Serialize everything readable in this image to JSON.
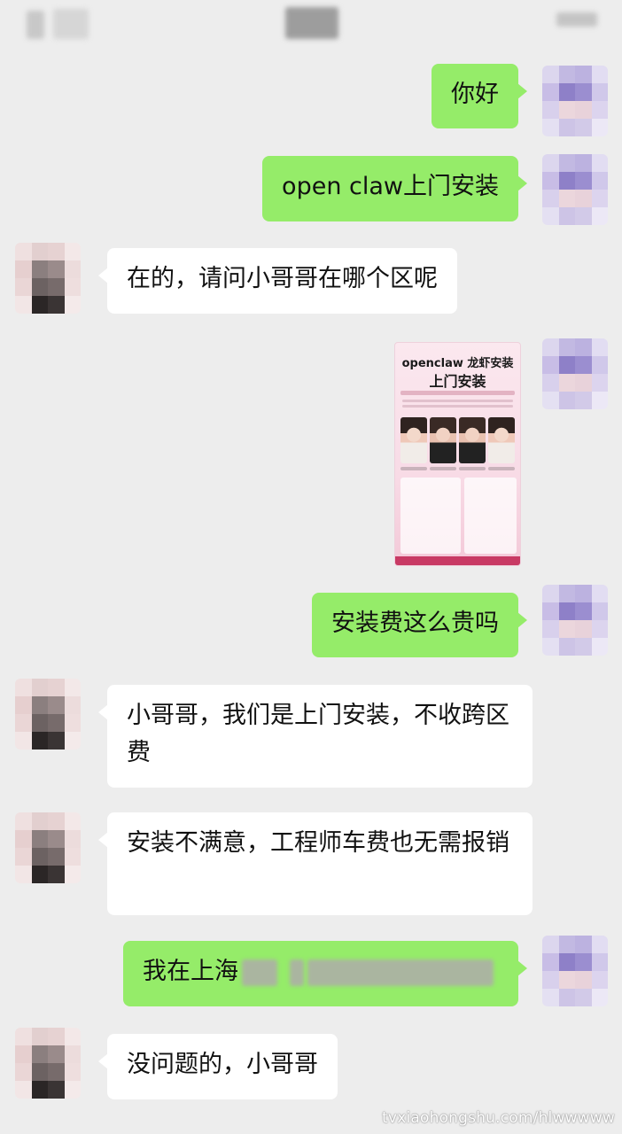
{
  "header": {},
  "messages": [
    {
      "from": "me",
      "type": "text",
      "text": "你好"
    },
    {
      "from": "me",
      "type": "text",
      "text": "open claw上门安装"
    },
    {
      "from": "them",
      "type": "text",
      "text": "在的，请问小哥哥在哪个区呢"
    },
    {
      "from": "me",
      "type": "image",
      "poster": {
        "title_line1": "openclaw 龙虾安装",
        "title_line2": "上门安装"
      }
    },
    {
      "from": "me",
      "type": "text",
      "text": "安装费这么贵吗"
    },
    {
      "from": "them",
      "type": "text",
      "text": "小哥哥，我们是上门安装，不收跨区费"
    },
    {
      "from": "them",
      "type": "text",
      "text": "安装不满意，工程师车费也无需报销"
    },
    {
      "from": "me",
      "type": "text",
      "text": "我在上海"
    },
    {
      "from": "them",
      "type": "text",
      "text": "没问题的，小哥哥"
    }
  ],
  "watermark": "tvxiaohongshu.com/hlwwwww",
  "colors": {
    "me_bubble": "#95ec69",
    "them_bubble": "#ffffff",
    "background": "#ededed"
  }
}
